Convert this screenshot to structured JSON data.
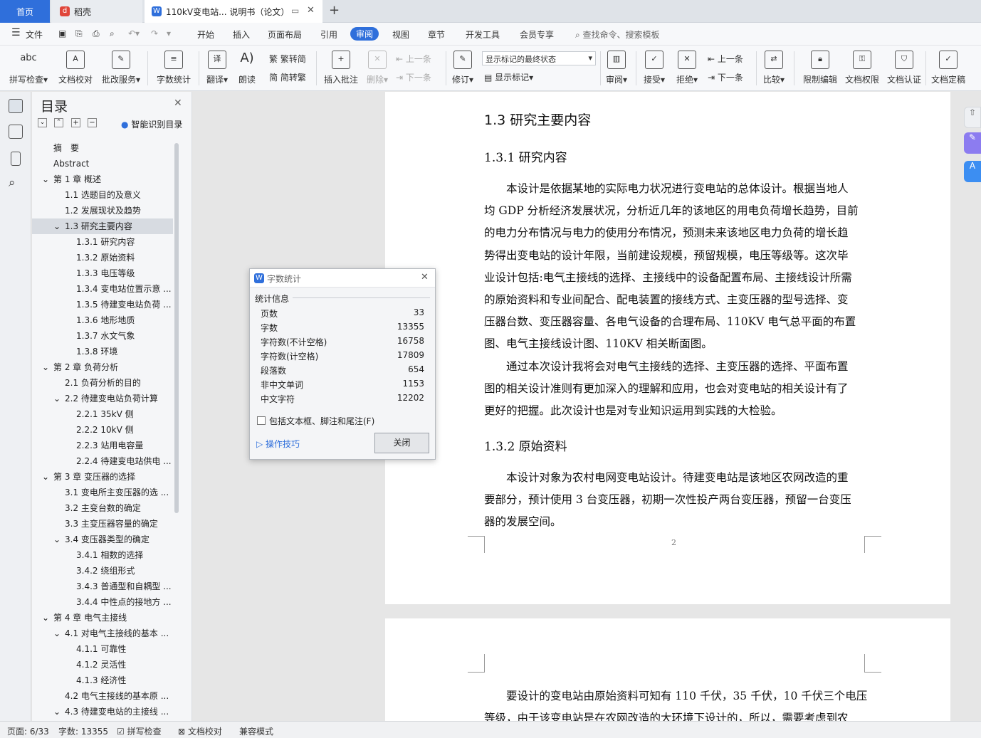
{
  "tabs": {
    "home": "首页",
    "daoke": "稻壳",
    "doc": "110kV变电站... 说明书（论文）"
  },
  "menu": {
    "file": "文件",
    "items": [
      "开始",
      "插入",
      "页面布局",
      "引用",
      "审阅",
      "视图",
      "章节",
      "开发工具",
      "会员专享"
    ],
    "search": "查找命令、搜索模板"
  },
  "ribbon": {
    "spell": "拼写检查",
    "proof": "文档校对",
    "batch": "批改服务",
    "count": "字数统计",
    "translate": "翻译",
    "read": "朗读",
    "trad": "繁转简",
    "simp": "简转繁",
    "insert_comment": "插入批注",
    "delete": "删除",
    "prev": "上一条",
    "next": "下一条",
    "revise": "修订",
    "markup_select": "显示标记的最终状态",
    "show_markup": "显示标记",
    "review": "审阅",
    "accept": "接受",
    "reject": "拒绝",
    "prev2": "上一条",
    "next2": "下一条",
    "compare": "比较",
    "restrict": "限制编辑",
    "perm": "文档权限",
    "cert": "文档认证",
    "final": "文档定稿"
  },
  "nav": {
    "title": "目录",
    "smart": "智能识别目录",
    "items": [
      {
        "t": "摘　要",
        "lv": 0
      },
      {
        "t": "Abstract",
        "lv": 0
      },
      {
        "t": "第 1 章  概述",
        "lv": 1
      },
      {
        "t": "1.1 选题目的及意义",
        "lv": 2
      },
      {
        "t": "1.2 发展现状及趋势",
        "lv": 2
      },
      {
        "t": "1.3 研究主要内容",
        "lv": 3
      },
      {
        "t": "1.3.1 研究内容",
        "lv": 4
      },
      {
        "t": "1.3.2 原始资料",
        "lv": 4
      },
      {
        "t": "1.3.3 电压等级",
        "lv": 4
      },
      {
        "t": "1.3.4 变电站位置示意 ...",
        "lv": 4
      },
      {
        "t": "1.3.5 待建变电站负荷 ...",
        "lv": 4
      },
      {
        "t": "1.3.6 地形地质",
        "lv": 4
      },
      {
        "t": "1.3.7 水文气象",
        "lv": 4
      },
      {
        "t": "1.3.8 环境",
        "lv": 4
      },
      {
        "t": "第 2 章  负荷分析",
        "lv": 1
      },
      {
        "t": "2.1 负荷分析的目的",
        "lv": 2
      },
      {
        "t": "2.2 待建变电站负荷计算",
        "lv": 3
      },
      {
        "t": "2.2.1 35kV 侧",
        "lv": 4
      },
      {
        "t": "2.2.2 10kV 侧",
        "lv": 4
      },
      {
        "t": "2.2.3   站用电容量",
        "lv": 4
      },
      {
        "t": "2.2.4   待建变电站供电 ...",
        "lv": 4
      },
      {
        "t": "第 3 章  变压器的选择",
        "lv": 1
      },
      {
        "t": "3.1 变电所主变压器的选 ...",
        "lv": 2
      },
      {
        "t": "3.2 主变台数的确定",
        "lv": 2
      },
      {
        "t": "3.3 主变压器容量的确定",
        "lv": 2
      },
      {
        "t": "3.4  变压器类型的确定",
        "lv": 3
      },
      {
        "t": "3.4.1 相数的选择",
        "lv": 4
      },
      {
        "t": "3.4.2   绕组形式",
        "lv": 4
      },
      {
        "t": "3.4.3   普通型和自耦型 ...",
        "lv": 4
      },
      {
        "t": "3.4.4   中性点的接地方 ...",
        "lv": 4
      },
      {
        "t": "第 4 章  电气主接线",
        "lv": 1
      },
      {
        "t": "4.1 对电气主接线的基本 ...",
        "lv": 3
      },
      {
        "t": "4.1.1 可靠性",
        "lv": 4
      },
      {
        "t": "4.1.2 灵活性",
        "lv": 4
      },
      {
        "t": "4.1.3 经济性",
        "lv": 4
      },
      {
        "t": "4.2 电气主接线的基本原 ...",
        "lv": 2
      },
      {
        "t": "4.3 待建变电站的主接线 ...",
        "lv": 3
      }
    ]
  },
  "doc": {
    "h1": "1.3 研究主要内容",
    "h2a": "1.3.1 研究内容",
    "para1_lines": [
      "　　本设计是依据某地的实际电力状况进行变电站的总体设计。根据当地人",
      "均 GDP 分析经济发展状况，分析近几年的该地区的用电负荷增长趋势，目前",
      "的电力分布情况与电力的使用分布情况，预测未来该地区电力负荷的增长趋",
      "势得出变电站的设计年限，当前建设规模，预留规模，电压等级等。这次毕",
      "业设计包括:电气主接线的选择、主接线中的设备配置布局、主接线设计所需",
      "的原始资料和专业间配合、配电装置的接线方式、主变压器的型号选择、变",
      "压器台数、变压器容量、各电气设备的合理布局、110KV 电气总平面的布置",
      "图、电气主接线设计图、110KV 相关断面图。"
    ],
    "para2_lines": [
      "　　通过本次设计我将会对电气主接线的选择、主变压器的选择、平面布置",
      "图的相关设计准则有更加深入的理解和应用，也会对变电站的相关设计有了",
      "更好的把握。此次设计也是对专业知识运用到实践的大检验。"
    ],
    "h2b": "1.3.2 原始资料",
    "para3_lines": [
      "　　本设计对象为农村电网变电站设计。待建变电站是该地区农网改造的重",
      "要部分，预计使用 3 台变压器，初期一次性投产两台变压器，预留一台变压",
      "器的发展空间。"
    ],
    "page_no": "2",
    "page2_lines": [
      "　　要设计的变电站由原始资料可知有 110 千伏，35 千伏，10 千伏三个电压",
      "等级，由于该变电站是在农网改造的大环境下设计的，所以，需要考虑到农"
    ]
  },
  "dialog": {
    "title": "字数统计",
    "section": "统计信息",
    "rows": [
      {
        "k": "页数",
        "v": "33"
      },
      {
        "k": "字数",
        "v": "13355"
      },
      {
        "k": "字符数(不计空格)",
        "v": "16758"
      },
      {
        "k": "字符数(计空格)",
        "v": "17809"
      },
      {
        "k": "段落数",
        "v": "654"
      },
      {
        "k": "非中文单词",
        "v": "1153"
      },
      {
        "k": "中文字符",
        "v": "12202"
      }
    ],
    "checkbox": "包括文本框、脚注和尾注(F)",
    "tips": "操作技巧",
    "close": "关闭"
  },
  "status": {
    "page": "页面: 6/33",
    "words": "字数: 13355",
    "spell": "拼写检查",
    "proof": "文档校对",
    "compat": "兼容模式"
  },
  "colors": {
    "accent": "#2f6fdb",
    "wps_red": "#e0463a"
  }
}
